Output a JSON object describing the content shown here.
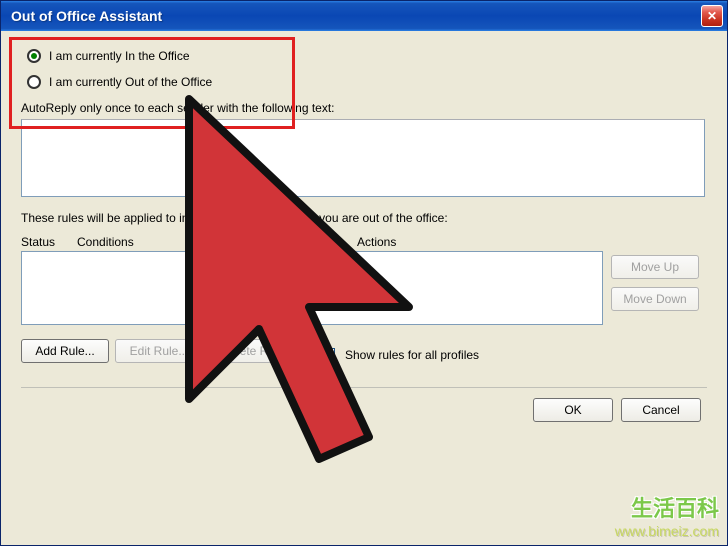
{
  "window": {
    "title": "Out of Office Assistant"
  },
  "radios": {
    "in_office": "I am currently In the Office",
    "out_office": "I am currently Out of the Office"
  },
  "autoreply_label": "AutoReply only once to each sender with the following text:",
  "rules_label": "These rules will be applied to incoming messages while you are out of the office:",
  "columns": {
    "status": "Status",
    "conditions": "Conditions",
    "actions": "Actions"
  },
  "buttons": {
    "move_up": "Move Up",
    "move_down": "Move Down",
    "add_rule": "Add Rule...",
    "edit_rule": "Edit Rule...",
    "delete_rule": "Delete Rule",
    "ok": "OK",
    "cancel": "Cancel"
  },
  "checkbox": {
    "show_rules": "Show rules for all profiles"
  },
  "watermark": {
    "line1": "生活百科",
    "line2": "www.bimeiz.com"
  }
}
